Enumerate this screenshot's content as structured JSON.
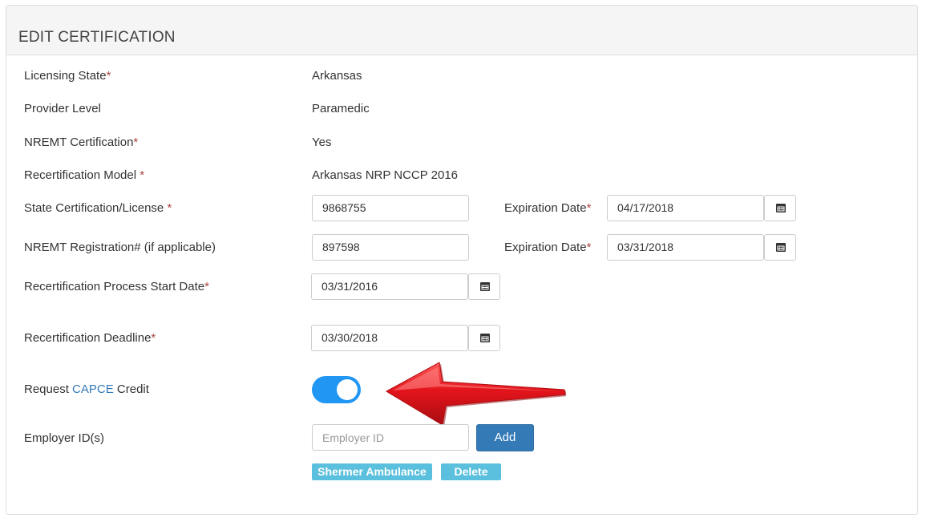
{
  "header": {
    "title": "EDIT CERTIFICATION"
  },
  "rows": [
    {
      "label": "Licensing State",
      "required": "*",
      "value": "Arkansas"
    },
    {
      "label": "Provider Level",
      "required": "",
      "value": "Paramedic"
    },
    {
      "label": "NREMT Certification",
      "required": "*",
      "value": "Yes"
    },
    {
      "label": "Recertification Model ",
      "required": "*",
      "value": "Arkansas NRP NCCP 2016"
    }
  ],
  "state_cert": {
    "label": "State Certification/License ",
    "required": "*",
    "value": "9868755",
    "exp_label": "Expiration Date",
    "exp_required": "*",
    "exp_value": "04/17/2018"
  },
  "nremt_reg": {
    "label": "NREMT Registration# (if applicable)",
    "value": "897598",
    "exp_label": "Expiration Date",
    "exp_required": "*",
    "exp_value": "03/31/2018"
  },
  "recert_start": {
    "label": "Recertification Process Start Date",
    "required": "*",
    "value": "03/31/2016"
  },
  "recert_deadline": {
    "label": "Recertification Deadline",
    "required": "*",
    "value": "03/30/2018"
  },
  "capce": {
    "label_prefix": "Request ",
    "link_text": "CAPCE",
    "label_suffix": " Credit",
    "enabled": true,
    "toggle_color": "#2196f3"
  },
  "employer": {
    "label": "Employer ID(s)",
    "placeholder": "Employer ID",
    "add_label": "Add",
    "tags": [
      "Shermer Ambulance"
    ],
    "delete_label": "Delete"
  },
  "icons": {
    "calendar": "calendar-icon",
    "annotation": "red-arrow"
  },
  "colors": {
    "primary": "#337ab7",
    "info": "#5bc0de",
    "required": "#a94442",
    "arrow": "#d9141b"
  }
}
